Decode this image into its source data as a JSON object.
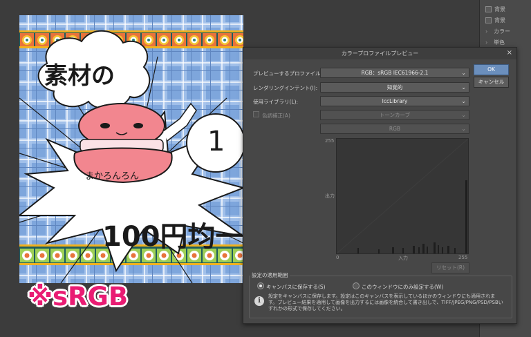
{
  "dialog": {
    "title": "カラープロファイルプレビュー",
    "close_glyph": "×",
    "preview_profile_label": "プレビューするプロファイル(C):",
    "preview_profile_value": "RGB：sRGB IEC61966-2.1",
    "rendering_intent_label": "レンダリングインテント(I):",
    "rendering_intent_value": "知覚的",
    "library_label": "使用ライブラリ(L):",
    "library_value": "IccLibrary",
    "tone_curve_label": "色調補正(A)",
    "tone_curve_select": "トーンカーブ",
    "channel_select": "RGB",
    "ok_label": "OK",
    "cancel_label": "キャンセル",
    "reset_label": "リセット(R)",
    "graph": {
      "y_max": "255",
      "y_label": "出力",
      "x_min": "0",
      "x_label": "入力",
      "x_max": "255"
    },
    "scope": {
      "title": "設定の適用範囲",
      "option_canvas": "キャンバスに保存する(S)",
      "option_window": "このウィンドウにのみ設定する(W)",
      "selected": "canvas",
      "info_text": "設定をキャンバスに保存します。設定はこのキャンバスを表示しているほかのウィンドウにも適用されます。プレビュー結果を適用して画像を出力するには画像を統合して書き出しで、TIFF/JPEG/PNG/PSD/PSBいずれかの形式で保存してください。"
    }
  },
  "right_panel": {
    "items": [
      "背景",
      "背景",
      "カラー",
      "単色",
      "",
      "",
      "",
      "",
      "",
      "",
      "",
      "",
      "",
      ""
    ]
  },
  "canvas": {
    "title_line": "素材の",
    "character_name": "まかろんろん",
    "circle_number": "1",
    "price_text": "100円均一"
  },
  "srgb_note": "※sRGB",
  "icons": {
    "info": "info-icon",
    "close": "close-icon",
    "caret": "chevron-down-icon"
  },
  "colors": {
    "ok_button": "#6b8fbd",
    "note": "#e91c73",
    "macaron": "#f2868f",
    "plaid": "#7ea6dc"
  }
}
